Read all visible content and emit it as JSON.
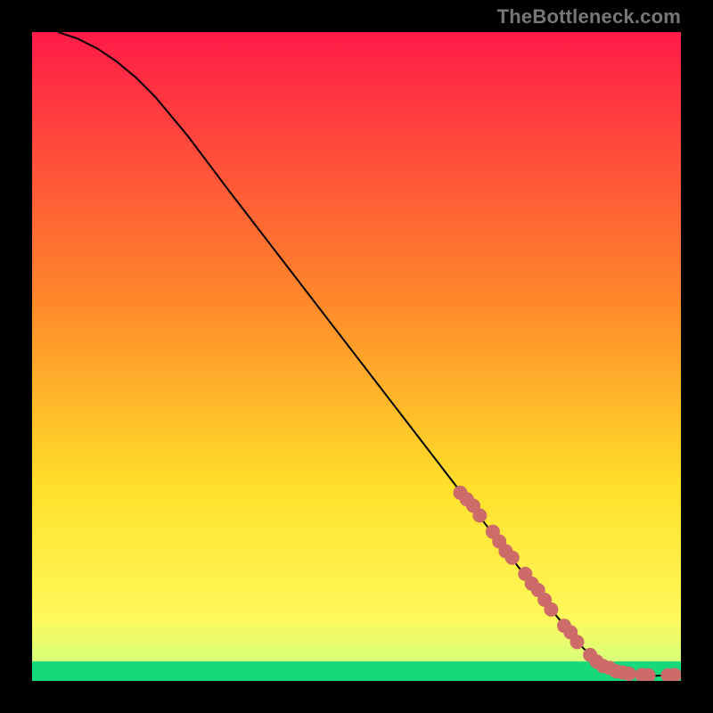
{
  "watermark": "TheBottleneck.com",
  "chart_data": {
    "type": "line",
    "title": "",
    "xlabel": "",
    "ylabel": "",
    "xlim": [
      0,
      100
    ],
    "ylim": [
      0,
      100
    ],
    "gradient_bg": {
      "top_color": "#ff1b48",
      "mid_color": "#fff200",
      "low_color": "#ffff66",
      "green_band": "#16d97b",
      "green_band_top": 3.0,
      "green_band_bottom": 0.0
    },
    "series": [
      {
        "name": "curve",
        "x": [
          4,
          7,
          10,
          13,
          16,
          19,
          24,
          30,
          40,
          50,
          60,
          70,
          80,
          85,
          88,
          90,
          92,
          94,
          96,
          98,
          100
        ],
        "y": [
          100,
          99,
          97.5,
          95.5,
          93,
          90,
          84,
          76,
          63,
          50,
          37,
          24,
          11,
          5,
          2.3,
          1.5,
          1.1,
          0.9,
          0.8,
          0.85,
          0.9
        ]
      }
    ],
    "markers": {
      "name": "highlighted-segment",
      "color": "#cd6b69",
      "x": [
        66,
        67,
        68,
        69,
        71,
        72,
        73,
        74,
        76,
        77,
        78,
        79,
        80,
        82,
        83,
        84,
        86,
        87,
        88,
        89,
        90,
        91,
        92,
        94,
        95,
        98,
        99
      ],
      "y": [
        29,
        28,
        27,
        25.5,
        23,
        21.5,
        20,
        19,
        16.5,
        15,
        14,
        12.5,
        11,
        8.5,
        7.5,
        6,
        4,
        3,
        2.3,
        2,
        1.5,
        1.3,
        1.1,
        0.9,
        0.85,
        0.85,
        0.9
      ]
    }
  }
}
